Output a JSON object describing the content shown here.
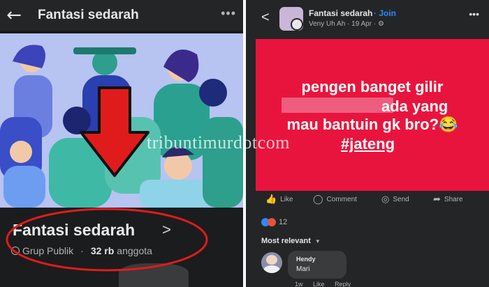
{
  "left": {
    "header": {
      "back_icon": "arrow-left-icon",
      "title": "Fantasi sedarah",
      "more_icon": "ellipsis-horizontal-icon"
    },
    "group": {
      "name": "Fantasi sedarah",
      "chevron": ">",
      "privacy": "Grup Publik",
      "separator": "·",
      "members_count": "32 rb",
      "members_label": "anggota"
    },
    "annotations": {
      "arrow_color": "#e01b1b",
      "ellipse_color": "#e01b1b"
    }
  },
  "right": {
    "header": {
      "back_icon": "chevron-left-icon",
      "group_name": "Fantasi sedarah",
      "join": "· Join",
      "meta": "Veny Uh Ah · 19 Apr · ⚙",
      "more_icon": "ellipsis-horizontal-icon"
    },
    "post": {
      "background": "#e9143d",
      "line1": "pengen banget gilir",
      "line2": "ada yang",
      "line3": "mau bantuin gk bro?😂",
      "line4": "#jateng"
    },
    "actions": {
      "like": "Like",
      "comment": "Comment",
      "send": "Send",
      "share": "Share"
    },
    "reactions": {
      "count": "12"
    },
    "sort": {
      "label": "Most relevant"
    },
    "comment": {
      "author": "Hendy",
      "text": "Mari",
      "time": "1w",
      "like": "Like",
      "reply": "Reply"
    }
  },
  "watermark": "tribuntimurdotcom"
}
